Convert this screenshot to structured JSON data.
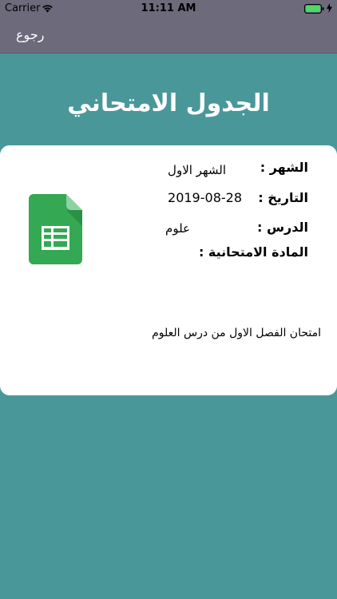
{
  "status_bar": {
    "carrier": "Carrier",
    "time": "11:11 AM",
    "wifi_icon": "wifi-icon",
    "battery_icon": "battery-icon",
    "charging_icon": "charging-bolt-icon"
  },
  "nav": {
    "back_label": "رجوع"
  },
  "header": {
    "title": "الجدول الامتحاني"
  },
  "card": {
    "icon": "spreadsheet-icon",
    "month_label": "الشهر :",
    "month_value": "الشهر الاول",
    "date_label": "التاريخ :",
    "date_value": "2019-08-28",
    "lesson_label": "الدرس :",
    "lesson_value": "علوم",
    "subject_label": "المادة الامتحانية :",
    "description": "امتحان الفصل الاول من درس العلوم"
  },
  "colors": {
    "background": "#4a979a",
    "bar": "#6c6a7b",
    "sheets_green": "#34a853"
  }
}
